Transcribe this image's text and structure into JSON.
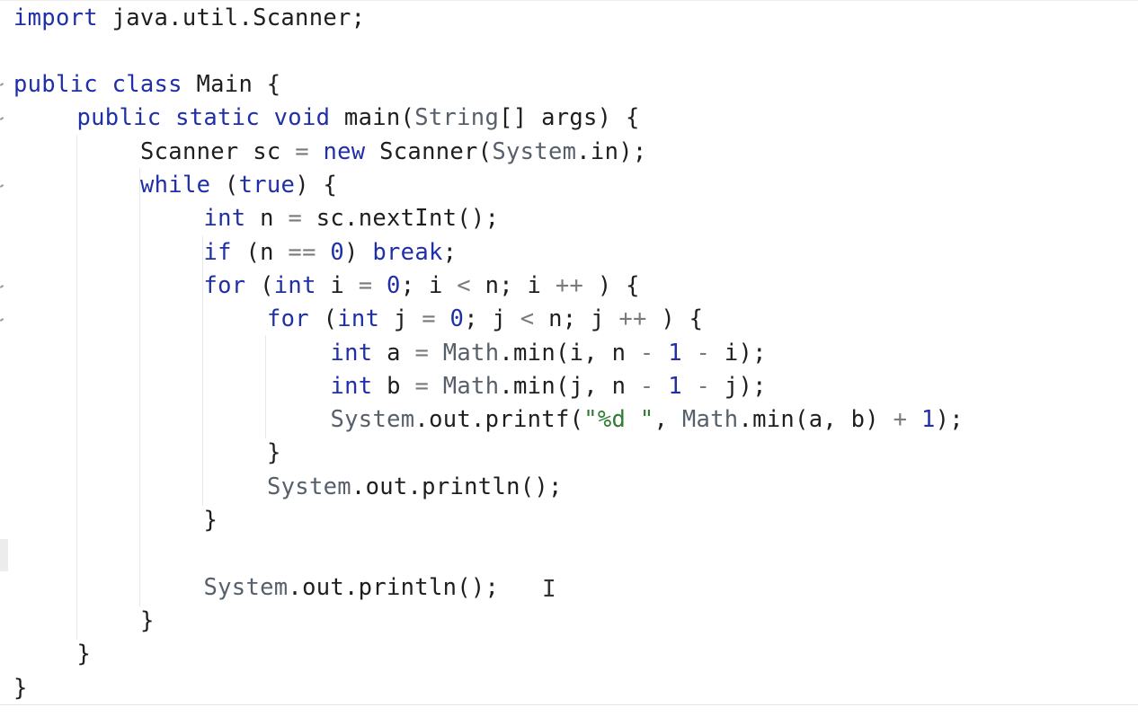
{
  "editor": {
    "language": "Java",
    "lines": [
      {
        "indent": 0,
        "tokens": [
          [
            "kw",
            "import"
          ],
          [
            "plain",
            " java.util.Scanner;"
          ]
        ]
      },
      {
        "indent": 0,
        "tokens": []
      },
      {
        "indent": 0,
        "tokens": [
          [
            "kw",
            "public"
          ],
          [
            "plain",
            " "
          ],
          [
            "kw",
            "class"
          ],
          [
            "plain",
            " Main {"
          ]
        ]
      },
      {
        "indent": 1,
        "tokens": [
          [
            "kw",
            "public"
          ],
          [
            "plain",
            " "
          ],
          [
            "kw",
            "static"
          ],
          [
            "plain",
            " "
          ],
          [
            "kw",
            "void"
          ],
          [
            "plain",
            " main("
          ],
          [
            "type",
            "String"
          ],
          [
            "plain",
            "[] args) {"
          ]
        ]
      },
      {
        "indent": 2,
        "tokens": [
          [
            "plain",
            "Scanner sc "
          ],
          [
            "op",
            "="
          ],
          [
            "plain",
            " "
          ],
          [
            "kw",
            "new"
          ],
          [
            "plain",
            " Scanner("
          ],
          [
            "type",
            "System"
          ],
          [
            "plain",
            ".in);"
          ]
        ]
      },
      {
        "indent": 2,
        "tokens": [
          [
            "kw",
            "while"
          ],
          [
            "plain",
            " ("
          ],
          [
            "kw",
            "true"
          ],
          [
            "plain",
            ") {"
          ]
        ]
      },
      {
        "indent": 3,
        "tokens": [
          [
            "kw",
            "int"
          ],
          [
            "plain",
            " n "
          ],
          [
            "op",
            "="
          ],
          [
            "plain",
            " sc.nextInt();"
          ]
        ]
      },
      {
        "indent": 3,
        "tokens": [
          [
            "kw",
            "if"
          ],
          [
            "plain",
            " (n "
          ],
          [
            "op",
            "=="
          ],
          [
            "plain",
            " "
          ],
          [
            "num",
            "0"
          ],
          [
            "plain",
            ") "
          ],
          [
            "kw",
            "break"
          ],
          [
            "plain",
            ";"
          ]
        ]
      },
      {
        "indent": 3,
        "tokens": [
          [
            "kw",
            "for"
          ],
          [
            "plain",
            " ("
          ],
          [
            "kw",
            "int"
          ],
          [
            "plain",
            " i "
          ],
          [
            "op",
            "="
          ],
          [
            "plain",
            " "
          ],
          [
            "num",
            "0"
          ],
          [
            "plain",
            "; i "
          ],
          [
            "op",
            "<"
          ],
          [
            "plain",
            " n; i "
          ],
          [
            "op",
            "++"
          ],
          [
            "plain",
            " ) {"
          ]
        ]
      },
      {
        "indent": 4,
        "tokens": [
          [
            "kw",
            "for"
          ],
          [
            "plain",
            " ("
          ],
          [
            "kw",
            "int"
          ],
          [
            "plain",
            " j "
          ],
          [
            "op",
            "="
          ],
          [
            "plain",
            " "
          ],
          [
            "num",
            "0"
          ],
          [
            "plain",
            "; j "
          ],
          [
            "op",
            "<"
          ],
          [
            "plain",
            " n; j "
          ],
          [
            "op",
            "++"
          ],
          [
            "plain",
            " ) {"
          ]
        ]
      },
      {
        "indent": 5,
        "tokens": [
          [
            "kw",
            "int"
          ],
          [
            "plain",
            " a "
          ],
          [
            "op",
            "="
          ],
          [
            "plain",
            " "
          ],
          [
            "type",
            "Math"
          ],
          [
            "plain",
            ".min(i, n "
          ],
          [
            "op",
            "-"
          ],
          [
            "plain",
            " "
          ],
          [
            "num",
            "1"
          ],
          [
            "plain",
            " "
          ],
          [
            "op",
            "-"
          ],
          [
            "plain",
            " i);"
          ]
        ]
      },
      {
        "indent": 5,
        "tokens": [
          [
            "kw",
            "int"
          ],
          [
            "plain",
            " b "
          ],
          [
            "op",
            "="
          ],
          [
            "plain",
            " "
          ],
          [
            "type",
            "Math"
          ],
          [
            "plain",
            ".min(j, n "
          ],
          [
            "op",
            "-"
          ],
          [
            "plain",
            " "
          ],
          [
            "num",
            "1"
          ],
          [
            "plain",
            " "
          ],
          [
            "op",
            "-"
          ],
          [
            "plain",
            " j);"
          ]
        ]
      },
      {
        "indent": 5,
        "tokens": [
          [
            "type",
            "System"
          ],
          [
            "plain",
            ".out.printf("
          ],
          [
            "str",
            "\"%d \""
          ],
          [
            "plain",
            ", "
          ],
          [
            "type",
            "Math"
          ],
          [
            "plain",
            ".min(a, b) "
          ],
          [
            "op",
            "+"
          ],
          [
            "plain",
            " "
          ],
          [
            "num",
            "1"
          ],
          [
            "plain",
            ");"
          ]
        ]
      },
      {
        "indent": 4,
        "tokens": [
          [
            "plain",
            "}"
          ]
        ]
      },
      {
        "indent": 4,
        "tokens": [
          [
            "type",
            "System"
          ],
          [
            "plain",
            ".out.println();"
          ]
        ]
      },
      {
        "indent": 3,
        "tokens": [
          [
            "plain",
            "}"
          ]
        ]
      },
      {
        "indent": 0,
        "tokens": []
      },
      {
        "indent": 3,
        "tokens": [
          [
            "type",
            "System"
          ],
          [
            "plain",
            ".out.println();"
          ]
        ]
      },
      {
        "indent": 2,
        "tokens": [
          [
            "plain",
            "}"
          ]
        ]
      },
      {
        "indent": 1,
        "tokens": [
          [
            "plain",
            "}"
          ]
        ]
      },
      {
        "indent": 0,
        "tokens": [
          [
            "plain",
            "}"
          ]
        ]
      }
    ]
  },
  "colors": {
    "keyword": "#1f2fa8",
    "type": "#57606a",
    "string": "#2e7d32",
    "operator": "#7a7a7a",
    "text": "#1e1e1e",
    "background": "#ffffff"
  },
  "cursor": {
    "icon": "text-cursor-ibeam-icon",
    "glyph": "I"
  }
}
